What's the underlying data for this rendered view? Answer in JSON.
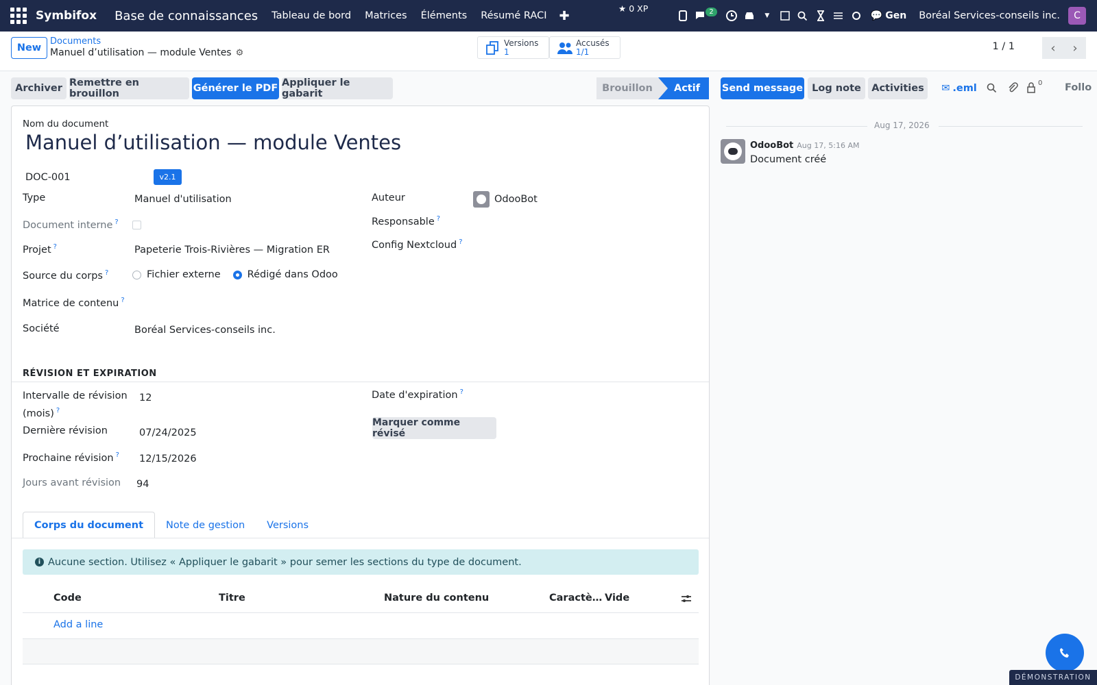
{
  "topbar": {
    "brand": "Symbifox",
    "app_title": "Base de connaissances",
    "menu": [
      "Tableau de bord",
      "Matrices",
      "Éléments",
      "Résumé RACI"
    ],
    "xp": "0 XP",
    "chat_badge": "2",
    "gen": "Gen",
    "company": "Boréal Services-conseils inc.",
    "avatar": "C"
  },
  "control": {
    "new": "New",
    "breadcrumb_parent": "Documents",
    "breadcrumb_current": "Manuel d’utilisation — module Ventes",
    "versions_label": "Versions",
    "versions_value": "1",
    "acks_label": "Accusés",
    "acks_value": "1/1",
    "pager": "1 / 1"
  },
  "actions": {
    "archive": "Archiver",
    "reset_draft": "Remettre en brouillon",
    "generate_pdf": "Générer le PDF",
    "apply_template": "Appliquer le gabarit",
    "status_draft": "Brouillon",
    "status_active": "Actif"
  },
  "form": {
    "name_label": "Nom du document",
    "name": "Manuel d’utilisation — module Ventes",
    "ref": "DOC-001",
    "version": "v2.1",
    "type_label": "Type",
    "type": "Manuel d'utilisation",
    "internal_label": "Document interne",
    "project_label": "Projet",
    "project": "Papeterie Trois-Rivières — Migration ER",
    "body_source_label": "Source du corps",
    "body_source_options": [
      "Fichier externe",
      "Rédigé dans Odoo"
    ],
    "content_matrix_label": "Matrice de contenu",
    "company_label": "Société",
    "company": "Boréal Services-conseils inc.",
    "author_label": "Auteur",
    "author": "OdooBot",
    "responsible_label": "Responsable",
    "nextcloud_label": "Config Nextcloud",
    "revision_section": "RÉVISION ET EXPIRATION",
    "interval_label_1": "Intervalle de révision",
    "interval_label_2": "(mois)",
    "interval": "12",
    "last_rev_label": "Dernière révision",
    "last_rev": "07/24/2025",
    "next_rev_label": "Prochaine révision",
    "next_rev": "12/15/2026",
    "days_label": "Jours avant révision",
    "days": "94",
    "expiry_label": "Date d'expiration",
    "mark_reviewed": "Marquer comme révisé"
  },
  "tabs": [
    "Corps du document",
    "Note de gestion",
    "Versions"
  ],
  "alert": "Aucune section. Utilisez « Appliquer le gabarit » pour semer les sections du type de document.",
  "table": {
    "columns": [
      "Code",
      "Titre",
      "Nature du contenu",
      "Caractè…",
      "Vide"
    ],
    "add_line": "Add a line"
  },
  "chatter": {
    "send_message": "Send message",
    "log_note": "Log note",
    "activities": "Activities",
    "eml": ".eml",
    "followers_count": "0",
    "follow": "Follo",
    "date": "Aug 17, 2026",
    "author": "OdooBot",
    "time": "Aug 17, 5:16 AM",
    "message": "Document créé"
  },
  "demo": "DÉMONSTRATION",
  "colors": {
    "navbar": "#1e2a4a",
    "primary": "#1a73e8",
    "alert_bg": "#d3eef1",
    "avatar": "#9b59b6"
  }
}
